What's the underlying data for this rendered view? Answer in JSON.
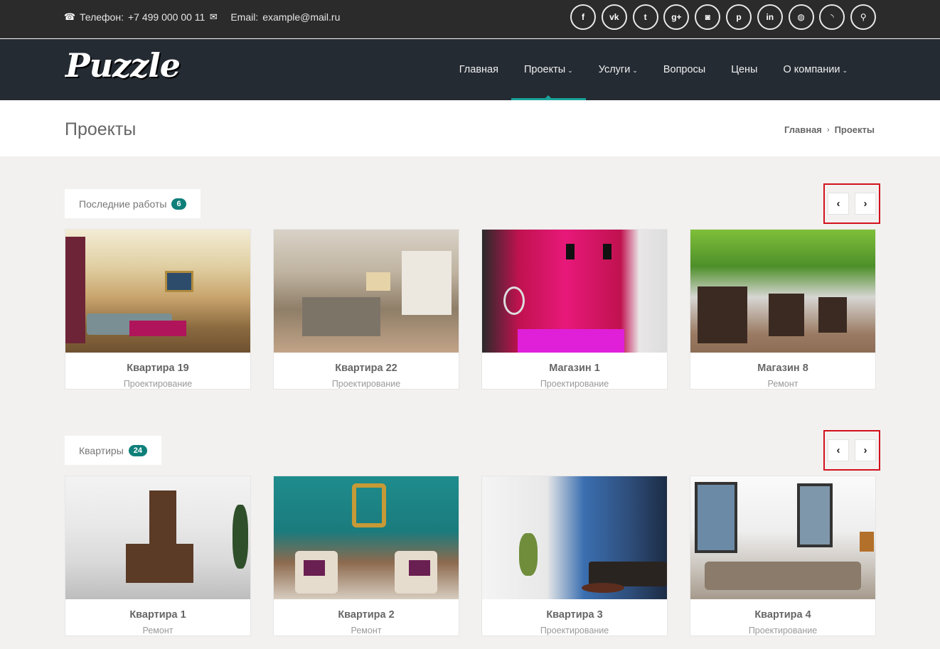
{
  "topbar": {
    "phone_label": "Телефон:",
    "phone": "+7 499 000 00 11",
    "email_label": "Email:",
    "email": "example@mail.ru",
    "social": [
      {
        "name": "facebook-icon",
        "glyph": "f"
      },
      {
        "name": "vk-icon",
        "glyph": "vk"
      },
      {
        "name": "twitter-icon",
        "glyph": "t"
      },
      {
        "name": "google-plus-icon",
        "glyph": "g+"
      },
      {
        "name": "instagram-icon",
        "glyph": "◙"
      },
      {
        "name": "pinterest-icon",
        "glyph": "p"
      },
      {
        "name": "linkedin-icon",
        "glyph": "in"
      },
      {
        "name": "dribbble-icon",
        "glyph": "◍"
      },
      {
        "name": "rss-icon",
        "glyph": "◝"
      },
      {
        "name": "search-icon",
        "glyph": "⚲"
      }
    ]
  },
  "nav": {
    "logo": "Puzzle",
    "items": [
      {
        "label": "Главная",
        "dropdown": false
      },
      {
        "label": "Проекты",
        "dropdown": true,
        "active": true
      },
      {
        "label": "Услуги",
        "dropdown": true
      },
      {
        "label": "Вопросы",
        "dropdown": false
      },
      {
        "label": "Цены",
        "dropdown": false
      },
      {
        "label": "О компании",
        "dropdown": true
      }
    ]
  },
  "page": {
    "title": "Проекты",
    "breadcrumb": [
      "Главная",
      "Проекты"
    ]
  },
  "sections": [
    {
      "title": "Последние работы",
      "count": "6",
      "cards": [
        {
          "title": "Квартира 19",
          "category": "Проектирование"
        },
        {
          "title": "Квартира 22",
          "category": "Проектирование"
        },
        {
          "title": "Магазин 1",
          "category": "Проектирование"
        },
        {
          "title": "Магазин 8",
          "category": "Ремонт"
        }
      ]
    },
    {
      "title": "Квартиры",
      "count": "24",
      "cards": [
        {
          "title": "Квартира 1",
          "category": "Ремонт"
        },
        {
          "title": "Квартира 2",
          "category": "Ремонт"
        },
        {
          "title": "Квартира 3",
          "category": "Проектирование"
        },
        {
          "title": "Квартира 4",
          "category": "Проектирование"
        }
      ]
    }
  ],
  "colors": {
    "accent": "#1aa39b",
    "badge": "#0f7f7a",
    "highlight_box": "#d3101e",
    "topbar": "#2b2b2b",
    "navbar": "#252b33"
  },
  "icons": {
    "phone": "☎",
    "email": "✉",
    "caret": "⌄",
    "prev": "‹",
    "next": "›",
    "breadcrumb_sep": "›"
  }
}
